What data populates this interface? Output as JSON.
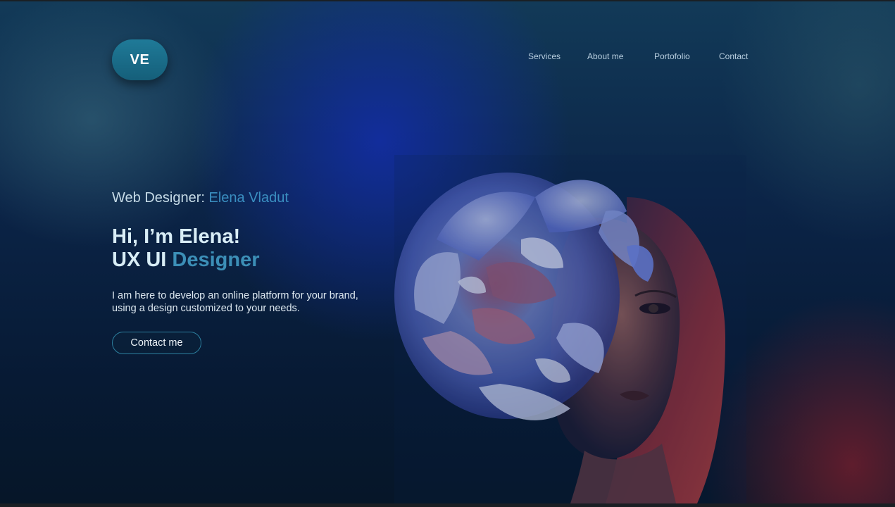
{
  "logo": {
    "text": "VE"
  },
  "nav": {
    "items": [
      {
        "label": "Services"
      },
      {
        "label": "About me"
      },
      {
        "label": "Portofolio"
      },
      {
        "label": "Contact"
      }
    ]
  },
  "hero": {
    "subtitle_prefix": "Web Designer: ",
    "subtitle_name": "Elena Vladut",
    "headline_line1": "Hi, I’m Elena!",
    "headline_line2_prefix": "UX UI ",
    "headline_line2_accent": "Designer",
    "description": "I am here to develop an online platform for your brand, using a design customized to your needs.",
    "cta_label": "Contact me",
    "image_icon": "portrait-with-peony-image"
  },
  "colors": {
    "accent": "#3a8ec0",
    "logo_bg": "#1f7a98",
    "background": "#0b2447",
    "text_light": "#d8edf6"
  }
}
